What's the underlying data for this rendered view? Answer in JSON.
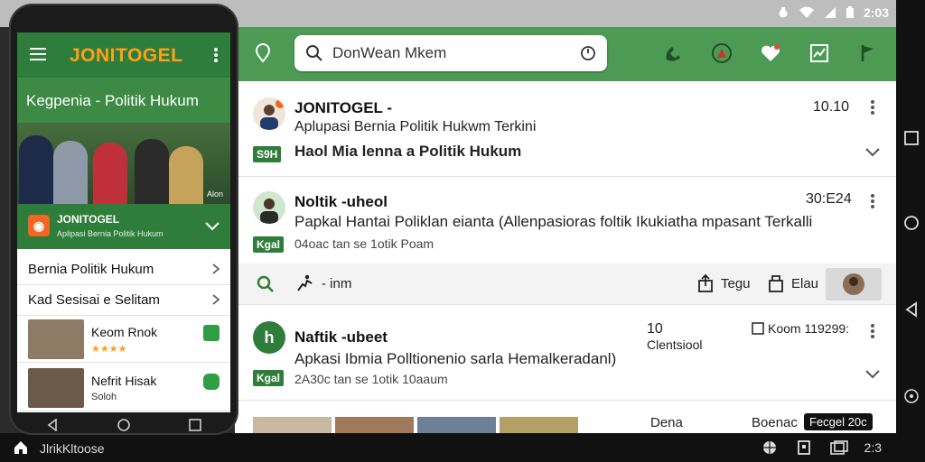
{
  "statusbar": {
    "time": "2:03"
  },
  "search": {
    "value": "DonWean Mkem"
  },
  "phone": {
    "brand": "JONITOGEL",
    "section_title": "Kegpenia - Politik Hukum",
    "hero_tag": "Alon",
    "band": {
      "title": "JONITOGEL",
      "subtitle": "Aplipasi Bernia Politik Hukum"
    },
    "rows": [
      {
        "label": "Bernia Politik Hukum"
      },
      {
        "label": "Kad Sesisai e Selitam"
      }
    ],
    "items": [
      {
        "title": "Keom Rnok",
        "rating": "★★★★"
      },
      {
        "title": "Nefrit Hisak",
        "sub": "Soloh"
      }
    ]
  },
  "feed": {
    "cards": [
      {
        "name": "JONITOGEL -",
        "subtitle": "Aplupasi Bernia Politik Hukwm Terkini",
        "badge": "S9H",
        "headline": "Haol Mia lenna a Politik Hukum",
        "meta": "10.10"
      },
      {
        "name": "Noltik -uheol",
        "headline": "Papkal Hantai Poliklan eianta (Allenpasioras foltik Ikukiatha mpasant Terkalli",
        "badge": "Kgal",
        "sub": "04oac tan se 1otik Poam",
        "meta": "30:E24"
      },
      {
        "name": "Naftik -ubeet",
        "headline": "Apkasi Ibmia Polltionenio sarla Hemalkeradanl)",
        "badge": "Kgal",
        "sub": "2A30c tan se 1otik 10aaum",
        "meta1": "10",
        "meta2": "Clentsiool",
        "meta3": "Koom 119299:",
        "avatar_letter": "h"
      }
    ],
    "actions": {
      "route": "- inm",
      "share": "Tegu",
      "save": "Elau"
    },
    "bottom_left": "Dena",
    "bottom_right": "Boenac",
    "bottom_chip": "Fecgel 20c"
  },
  "bottombar": {
    "label": "JlrikKltoose",
    "count": "2:3"
  },
  "colors": {
    "green": "#4d9a55",
    "dark_green": "#2f7d3a",
    "orange": "#ff9f1a"
  }
}
